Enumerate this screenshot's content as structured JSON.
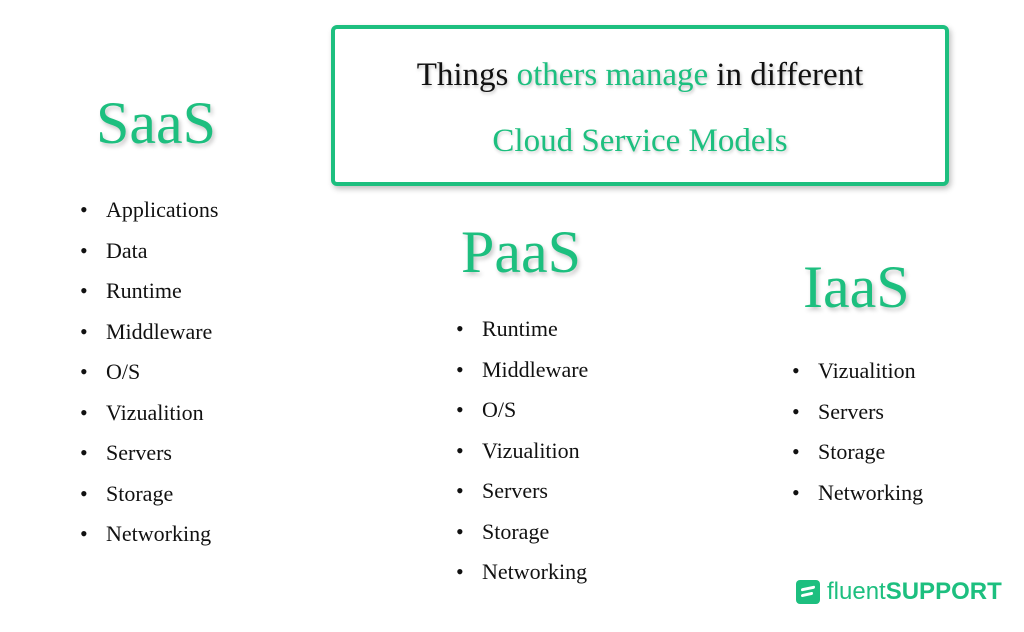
{
  "title": {
    "line1_prefix": "Things ",
    "line1_accent": "others manage",
    "line1_suffix": " in different",
    "line2": "Cloud Service Models"
  },
  "colors": {
    "accent": "#1dbf7f",
    "text": "#111111"
  },
  "models": [
    {
      "name": "SaaS",
      "items": [
        "Applications",
        "Data",
        "Runtime",
        "Middleware",
        "O/S",
        "Vizualition",
        "Servers",
        "Storage",
        "Networking"
      ]
    },
    {
      "name": "PaaS",
      "items": [
        "Runtime",
        "Middleware",
        "O/S",
        "Vizualition",
        "Servers",
        "Storage",
        "Networking"
      ]
    },
    {
      "name": "IaaS",
      "items": [
        "Vizualition",
        "Servers",
        "Storage",
        "Networking"
      ]
    }
  ],
  "logo": {
    "light": "fluent",
    "bold": "SUPPORT"
  }
}
